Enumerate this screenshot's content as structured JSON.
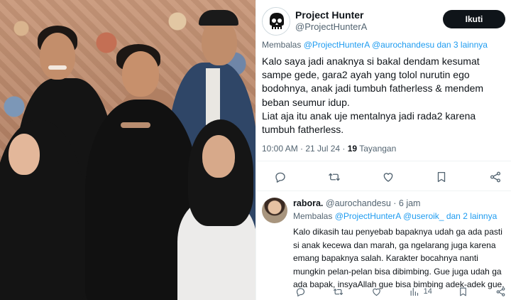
{
  "main_tweet": {
    "author_name": "Project Hunter",
    "author_handle": "@ProjectHunterA",
    "follow_label": "Ikuti",
    "reply_to": {
      "prefix": "Membalas",
      "mention1": "@ProjectHunterA",
      "mention2": "@aurochandesu",
      "joiner": "dan",
      "others": "3 lainnya"
    },
    "text_para1": "Kalo saya jadi anaknya si bakal dendam kesumat sampe gede, gara2 ayah yang tolol nurutin ego bodohnya, anak jadi tumbuh fatherless & mendem beban seumur idup.",
    "text_para2": "Liat aja itu anak uje mentalnya jadi rada2 karena tumbuh fatherless.",
    "time": "10:00 AM · 21 Jul 24 ·",
    "views_count": "19",
    "views_label": "Tayangan"
  },
  "main_actions": [
    "reply-icon",
    "retweet-icon",
    "like-icon",
    "bookmark-icon",
    "share-icon"
  ],
  "reply_tweet": {
    "author_name": "rabora.",
    "author_handle": "@aurochandesu · 6 jam",
    "reply_to": {
      "prefix": "Membalas",
      "mention1": "@ProjectHunterA",
      "mention2": "@useroik_",
      "joiner": "dan",
      "others": "2 lainnya"
    },
    "text": "Kalo dikasih tau penyebab bapaknya udah ga ada pasti si anak kecewa dan marah, ga ngelarang juga karena emang bapaknya salah. Karakter bocahnya nanti mungkin pelan-pelan bisa dibimbing. Gue juga udah ga ada bapak, insyaAllah gue bisa bimbing adek-adek gue.",
    "views": "14"
  },
  "colors": {
    "text": "#0f1419",
    "secondary": "#536471",
    "link": "#1d9bf0",
    "follow_bg": "#0f1419",
    "divider": "#eff3f4"
  }
}
